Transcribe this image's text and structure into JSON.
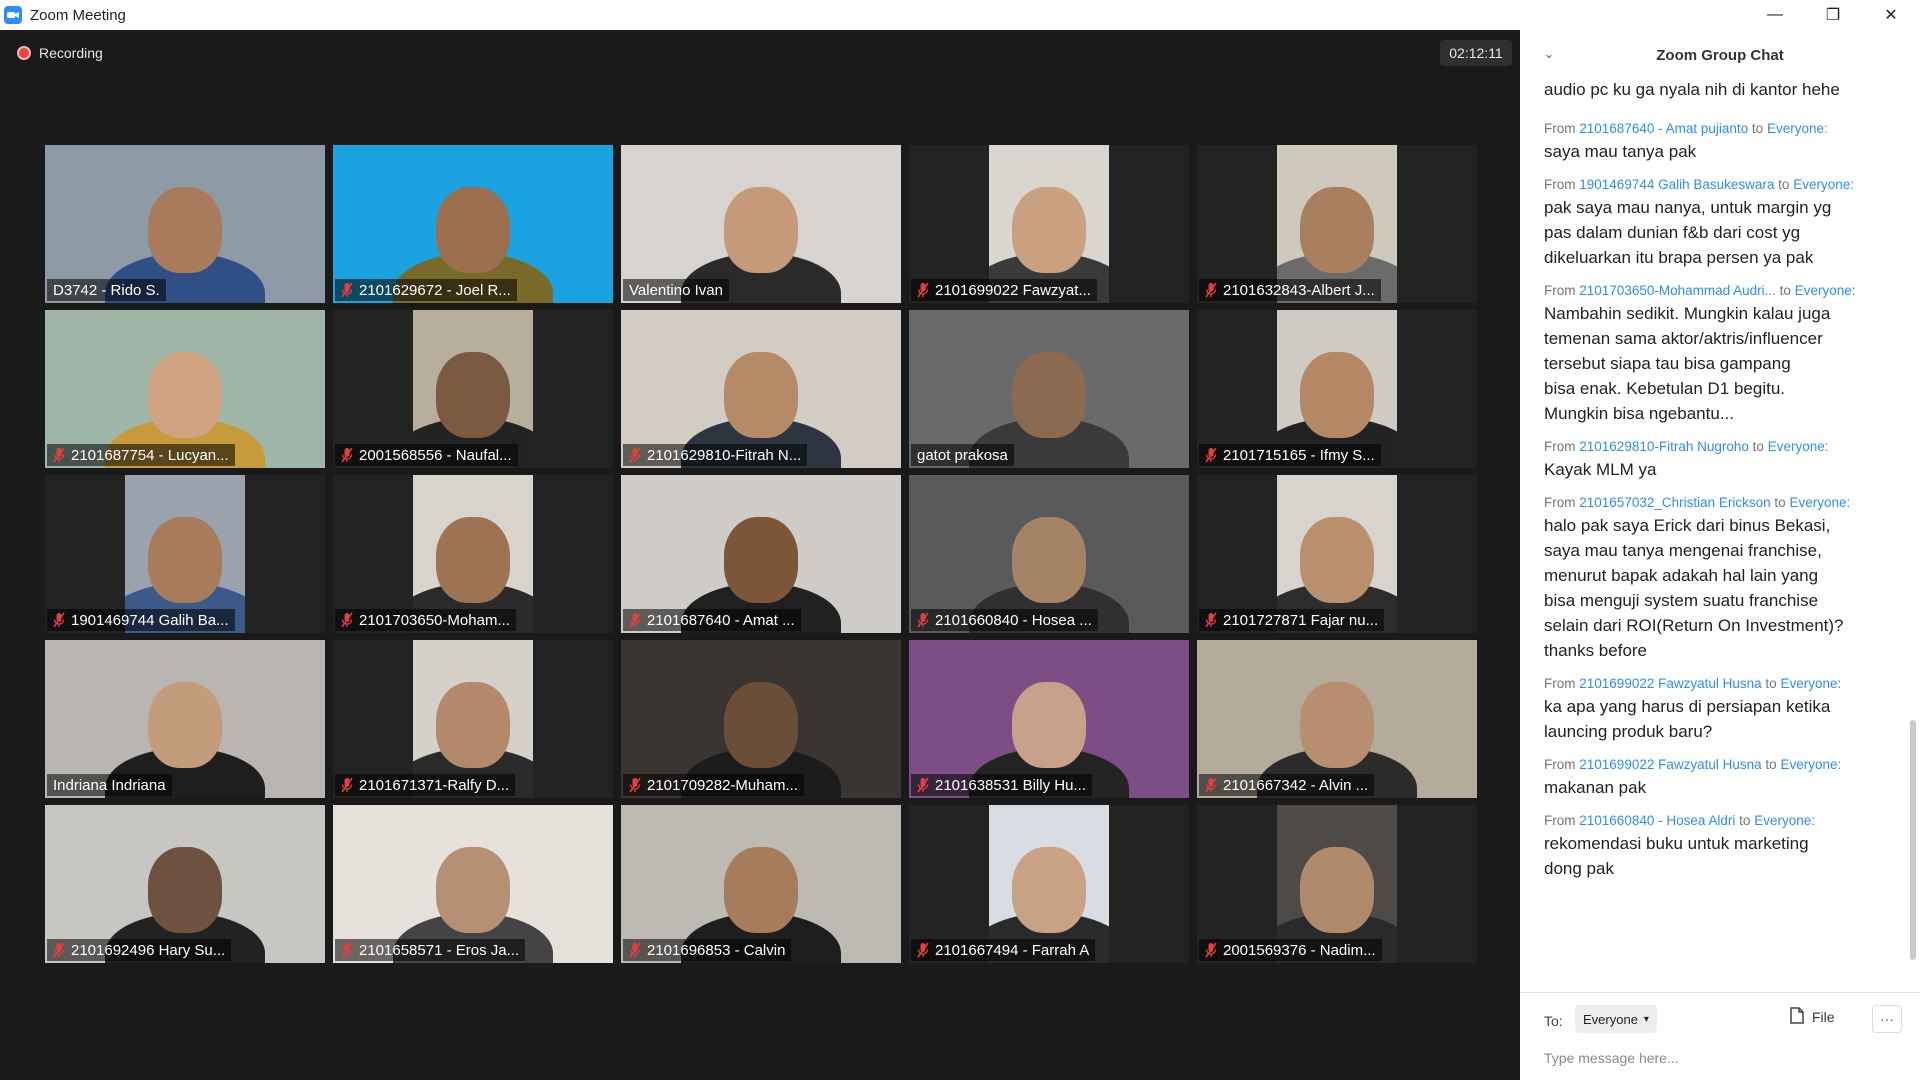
{
  "window": {
    "title": "Zoom Meeting"
  },
  "meeting": {
    "recording_label": "Recording",
    "timer": "02:12:11"
  },
  "tiles": [
    {
      "name": "D3742 - Rido S.",
      "muted": false,
      "video": "full",
      "bg": "#8e9aa6",
      "skin": "#a97b5c",
      "shirt": "#2f4f86"
    },
    {
      "name": "2101629672 - Joel R...",
      "muted": true,
      "video": "full",
      "bg": "#1aa3e0",
      "skin": "#9b6f4e",
      "shirt": "#7a6a2a"
    },
    {
      "name": "Valentino Ivan",
      "muted": false,
      "video": "full",
      "bg": "#d7d3cf",
      "skin": "#c59a7a",
      "shirt": "#2a2a2a"
    },
    {
      "name": "2101699022 Fawzyat...",
      "muted": true,
      "video": "mid",
      "bg": "#d9d6d0",
      "skin": "#c9a080",
      "shirt": "#3a3a3a"
    },
    {
      "name": "2101632843-Albert J...",
      "muted": true,
      "video": "mid",
      "bg": "#cfc8bd",
      "skin": "#a87f5f",
      "shirt": "#6b6b6b"
    },
    {
      "name": "2101687754 - Lucyan...",
      "muted": true,
      "video": "full",
      "bg": "#9fb7a8",
      "skin": "#d0a482",
      "shirt": "#c79a3a"
    },
    {
      "name": "2001568556 - Naufal...",
      "muted": true,
      "video": "mid",
      "bg": "#b8ae9c",
      "skin": "#7a5a40",
      "shirt": "#222222"
    },
    {
      "name": "2101629810-Fitrah N...",
      "muted": true,
      "video": "full",
      "bg": "#d2ccc4",
      "skin": "#b58a66",
      "shirt": "#2c3540"
    },
    {
      "name": "gatot prakosa",
      "muted": false,
      "video": "full",
      "bg": "#6a6a6a",
      "skin": "#8c6a50",
      "shirt": "#3a3a3a",
      "active": true
    },
    {
      "name": "2101715165 - Ifmy S...",
      "muted": true,
      "video": "mid",
      "bg": "#cfcac3",
      "skin": "#b48864",
      "shirt": "#222222"
    },
    {
      "name": "1901469744 Galih Ba...",
      "muted": true,
      "video": "mid",
      "bg": "#9aa3ad",
      "skin": "#a87c5a",
      "shirt": "#3b5a8a"
    },
    {
      "name": "2101703650-Moham...",
      "muted": true,
      "video": "mid",
      "bg": "#d8d4cc",
      "skin": "#9c7454",
      "shirt": "#2a2a2a"
    },
    {
      "name": "2101687640 - Amat ...",
      "muted": true,
      "video": "full",
      "bg": "#cfcbc6",
      "skin": "#7c5638",
      "shirt": "#202020"
    },
    {
      "name": "2101660840 - Hosea ...",
      "muted": true,
      "video": "full",
      "bg": "#5a5a5a",
      "skin": "#a58366",
      "shirt": "#303030"
    },
    {
      "name": "2101727871 Fajar nu...",
      "muted": true,
      "video": "mid",
      "bg": "#d9d3cd",
      "skin": "#b8906e",
      "shirt": "#2d2d2d"
    },
    {
      "name": "Indriana Indriana",
      "muted": false,
      "video": "full",
      "bg": "#b9b6b2",
      "skin": "#c39c7c",
      "shirt": "#1e1e1e"
    },
    {
      "name": "2101671371-Ralfy D...",
      "muted": true,
      "video": "mid",
      "bg": "#d5d0c8",
      "skin": "#b4886a",
      "shirt": "#2a2a2a"
    },
    {
      "name": "2101709282-Muham...",
      "muted": true,
      "video": "full",
      "bg": "#3a3432",
      "skin": "#6a4e3a",
      "shirt": "#1c1c1c"
    },
    {
      "name": "2101638531 Billy Hu...",
      "muted": true,
      "video": "full",
      "bg": "#7d4e86",
      "skin": "#c9a08a",
      "shirt": "#232323"
    },
    {
      "name": "2101667342 - Alvin ...",
      "muted": true,
      "video": "full",
      "bg": "#b4ab9b",
      "skin": "#b78f70",
      "shirt": "#2b2b2b"
    },
    {
      "name": "2101692496 Hary Su...",
      "muted": true,
      "video": "full",
      "bg": "#c8c6c2",
      "skin": "#6e5240",
      "shirt": "#222222"
    },
    {
      "name": "2101658571 - Eros Ja...",
      "muted": true,
      "video": "full",
      "bg": "#e6e1da",
      "skin": "#b69074",
      "shirt": "#444444"
    },
    {
      "name": "2101696853 - Calvin",
      "muted": true,
      "video": "full",
      "bg": "#bdbab4",
      "skin": "#a57c5c",
      "shirt": "#1e1e1e"
    },
    {
      "name": "2101667494 - Farrah A",
      "muted": true,
      "video": "mid",
      "bg": "#d7dde2",
      "skin": "#c9a286",
      "shirt": "#2a2a2a"
    },
    {
      "name": "2001569376 - Nadim...",
      "muted": true,
      "video": "mid",
      "bg": "#4d4a47",
      "skin": "#b18a6c",
      "shirt": "#2a2a2a"
    }
  ],
  "chat": {
    "title": "Zoom Group Chat",
    "first_text": "audio pc ku ga nyala nih di kantor hehe",
    "messages": [
      {
        "from_word": "From",
        "sender": "2101687640 - Amat pujianto",
        "to_word": "to",
        "recipient": "Everyone:",
        "text": "saya mau tanya pak"
      },
      {
        "from_word": "From",
        "sender": "1901469744 Galih Basukeswara",
        "to_word": "to",
        "recipient": "Everyone:",
        "text": "pak saya mau nanya, untuk margin yg\npas dalam dunian f&b dari cost yg\ndikeluarkan itu brapa persen ya pak"
      },
      {
        "from_word": "From",
        "sender": "2101703650-Mohammad Audri...",
        "to_word": "to",
        "recipient": "Everyone:",
        "text": "Nambahin sedikit. Mungkin kalau juga\ntemenan sama aktor/aktris/influencer\ntersebut siapa tau bisa gampang\n bisa enak. Kebetulan D1 begitu.\nMungkin bisa ngebantu..."
      },
      {
        "from_word": "From",
        "sender": "2101629810-Fitrah Nugroho",
        "to_word": "to",
        "recipient": "Everyone:",
        "text": "Kayak MLM ya"
      },
      {
        "from_word": "From",
        "sender": "2101657032_Christian Erickson",
        "to_word": "to",
        "recipient": "Everyone:",
        "text": "halo pak saya Erick dari binus Bekasi,\nsaya mau tanya mengenai franchise,\nmenurut bapak adakah hal lain yang\nbisa menguji system suatu franchise\nselain dari ROI(Return On Investment)?\nthanks before"
      },
      {
        "from_word": "From",
        "sender": "2101699022 Fawzyatul Husna",
        "to_word": "to",
        "recipient": "Everyone:",
        "text": "ka apa yang harus di persiapan ketika\nlauncing produk baru?"
      },
      {
        "from_word": "From",
        "sender": "2101699022 Fawzyatul Husna",
        "to_word": "to",
        "recipient": "Everyone:",
        "text": "makanan pak"
      },
      {
        "from_word": "From",
        "sender": "2101660840 - Hosea Aldri",
        "to_word": "to",
        "recipient": "Everyone:",
        "text": "rekomendasi buku untuk marketing\ndong pak"
      }
    ],
    "composer": {
      "to_label": "To:",
      "recipient_select": "Everyone",
      "file_label": "File",
      "more_label": "···",
      "placeholder": "Type message here..."
    }
  },
  "icons": {
    "app": "zoom-camera-icon",
    "record": "record-dot-icon",
    "mic": "mic-muted-icon",
    "file": "file-icon",
    "chevron": "chevron-down-icon"
  }
}
